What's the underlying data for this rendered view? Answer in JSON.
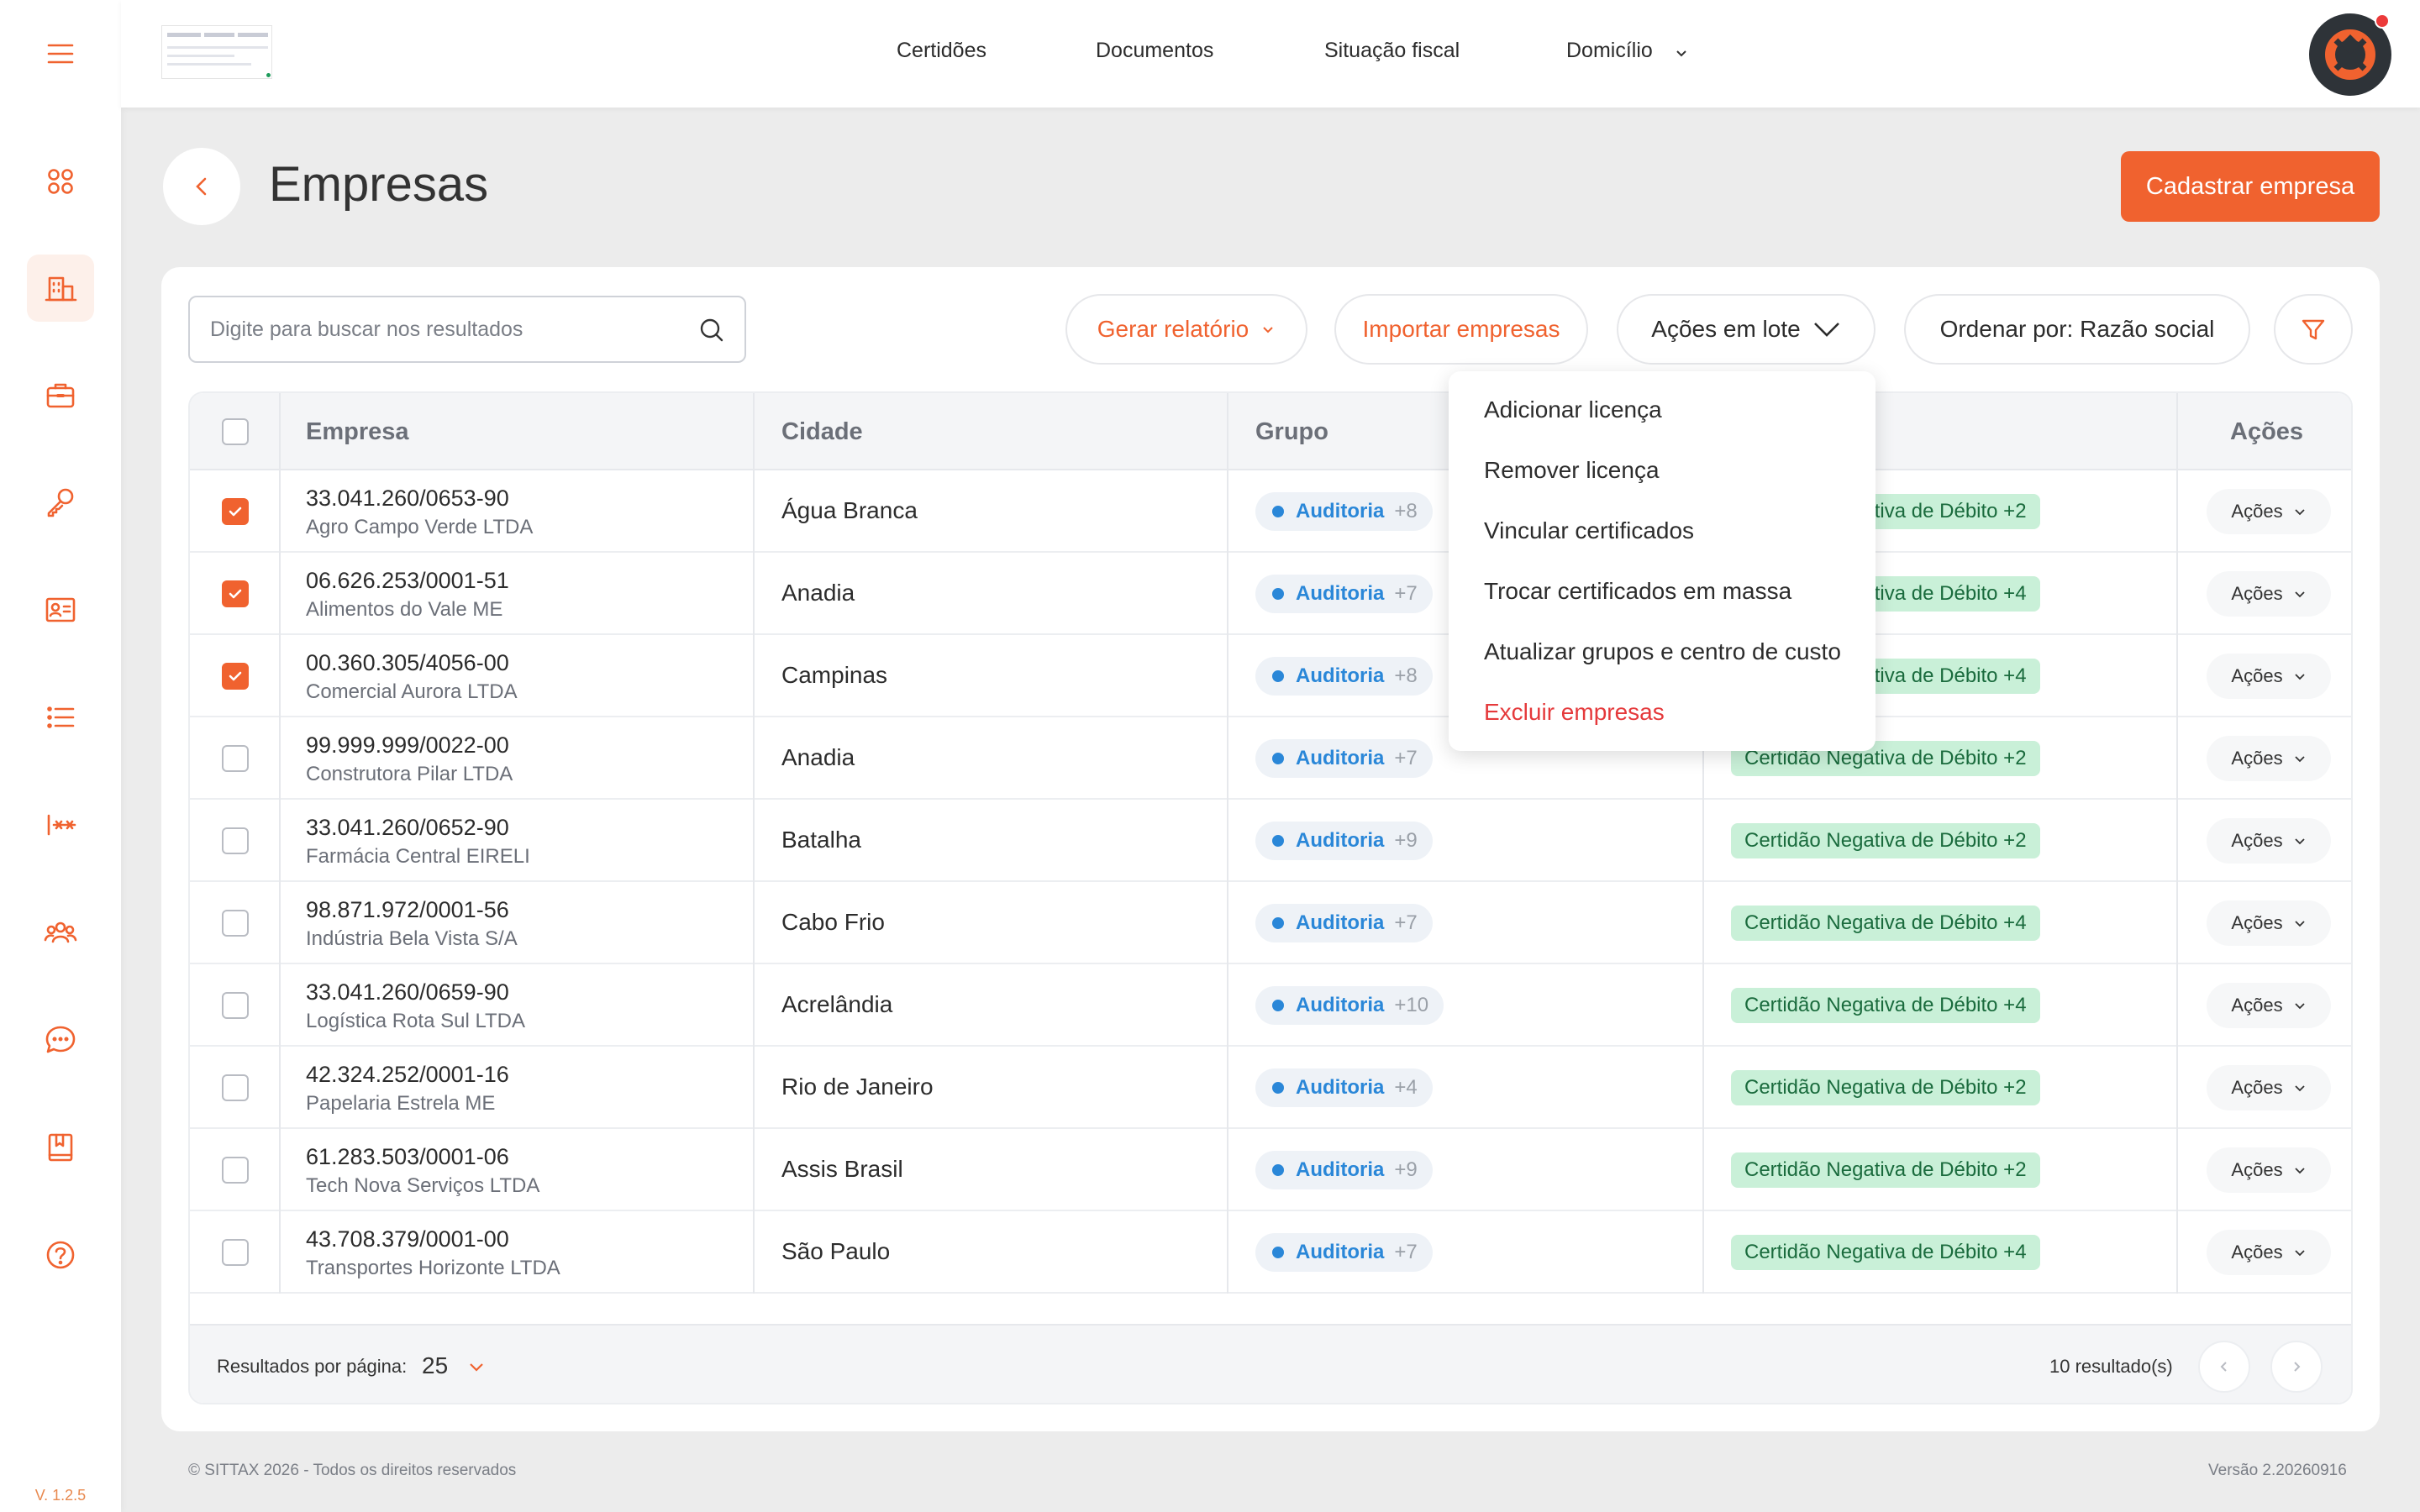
{
  "app": {
    "version_short": "V. 1.2.5"
  },
  "colors": {
    "accent": "#f0622f",
    "group_blue": "#2a87d8",
    "cert_green_bg": "#c9f0d8",
    "danger": "#e5393b"
  },
  "sidebar": {
    "items": [
      {
        "name": "dashboard",
        "icon": "apps-grid-icon"
      },
      {
        "name": "empresas",
        "icon": "buildings-icon",
        "active": true
      },
      {
        "name": "briefcase",
        "icon": "briefcase-icon"
      },
      {
        "name": "keys",
        "icon": "key-icon"
      },
      {
        "name": "contacts",
        "icon": "id-card-icon"
      },
      {
        "name": "lists",
        "icon": "list-icon"
      },
      {
        "name": "passwords",
        "icon": "password-icon"
      },
      {
        "name": "users",
        "icon": "users-icon"
      },
      {
        "name": "chat",
        "icon": "chat-icon"
      },
      {
        "name": "bookmarks",
        "icon": "book-bookmark-icon"
      },
      {
        "name": "help",
        "icon": "help-icon"
      }
    ]
  },
  "topnav": {
    "items": [
      "Certidões",
      "Documentos",
      "Situação fiscal",
      "Domicílio"
    ]
  },
  "page": {
    "title": "Empresas",
    "primary_action": "Cadastrar empresa"
  },
  "toolbar": {
    "search_placeholder": "Digite para buscar nos resultados",
    "report": "Gerar relatório",
    "import": "Importar empresas",
    "batch": "Ações em lote",
    "sort": "Ordenar por: Razão social"
  },
  "table": {
    "headers": {
      "empresa": "Empresa",
      "cidade": "Cidade",
      "grupo": "Grupo",
      "acoes": "Ações"
    },
    "rows": [
      {
        "checked": true,
        "cnpj": "33.041.260/0653-90",
        "name": "Agro Campo Verde LTDA",
        "city": "Água Branca",
        "group": "Auditoria",
        "group_more": "+8",
        "cert": "Certidão Negativa de Débito +2",
        "action": "Ações"
      },
      {
        "checked": true,
        "cnpj": "06.626.253/0001-51",
        "name": "Alimentos do Vale ME",
        "city": "Anadia",
        "group": "Auditoria",
        "group_more": "+7",
        "cert": "Certidão Negativa de Débito +4",
        "action": "Ações"
      },
      {
        "checked": true,
        "cnpj": "00.360.305/4056-00",
        "name": "Comercial Aurora LTDA",
        "city": "Campinas",
        "group": "Auditoria",
        "group_more": "+8",
        "cert": "Certidão Negativa de Débito +4",
        "action": "Ações"
      },
      {
        "checked": false,
        "cnpj": "99.999.999/0022-00",
        "name": "Construtora Pilar LTDA",
        "city": "Anadia",
        "group": "Auditoria",
        "group_more": "+7",
        "cert": "Certidão Negativa de Débito +2",
        "action": "Ações"
      },
      {
        "checked": false,
        "cnpj": "33.041.260/0652-90",
        "name": "Farmácia Central EIRELI",
        "city": "Batalha",
        "group": "Auditoria",
        "group_more": "+9",
        "cert": "Certidão Negativa de Débito +2",
        "action": "Ações"
      },
      {
        "checked": false,
        "cnpj": "98.871.972/0001-56",
        "name": "Indústria Bela Vista S/A",
        "city": "Cabo Frio",
        "group": "Auditoria",
        "group_more": "+7",
        "cert": "Certidão Negativa de Débito +4",
        "action": "Ações"
      },
      {
        "checked": false,
        "cnpj": "33.041.260/0659-90",
        "name": "Logística Rota Sul LTDA",
        "city": "Acrelândia",
        "group": "Auditoria",
        "group_more": "+10",
        "cert": "Certidão Negativa de Débito +4",
        "action": "Ações"
      },
      {
        "checked": false,
        "cnpj": "42.324.252/0001-16",
        "name": "Papelaria Estrela ME",
        "city": "Rio de Janeiro",
        "group": "Auditoria",
        "group_more": "+4",
        "cert": "Certidão Negativa de Débito +2",
        "action": "Ações"
      },
      {
        "checked": false,
        "cnpj": "61.283.503/0001-06",
        "name": "Tech Nova Serviços LTDA",
        "city": "Assis Brasil",
        "group": "Auditoria",
        "group_more": "+9",
        "cert": "Certidão Negativa de Débito +2",
        "action": "Ações"
      },
      {
        "checked": false,
        "cnpj": "43.708.379/0001-00",
        "name": "Transportes Horizonte LTDA",
        "city": "São Paulo",
        "group": "Auditoria",
        "group_more": "+7",
        "cert": "Certidão Negativa de Débito +4",
        "action": "Ações"
      }
    ]
  },
  "pagination": {
    "per_page_label": "Resultados por página:",
    "per_page": "25",
    "count": "10 resultado(s)"
  },
  "batch_menu": {
    "items": [
      "Adicionar licença",
      "Remover licença",
      "Vincular certificados",
      "Trocar certificados em massa",
      "Atualizar grupos e centro de custo",
      "Excluir empresas"
    ]
  },
  "footer": {
    "copyright": "© SITTAX 2026 - Todos os direitos reservados",
    "version": "Versão 2.20260916"
  }
}
